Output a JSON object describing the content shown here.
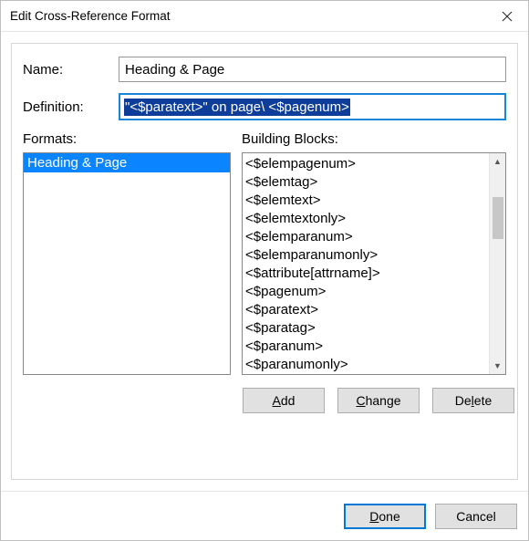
{
  "title": "Edit Cross-Reference Format",
  "labels": {
    "name": "Name:",
    "definition": "Definition:",
    "formats": "Formats:",
    "building_blocks": "Building Blocks:"
  },
  "fields": {
    "name_value": "Heading & Page",
    "definition_value": "\"<$paratext>\" on page\\ <$pagenum>"
  },
  "formats": [
    {
      "label": "Heading & Page",
      "selected": true
    }
  ],
  "building_blocks": [
    "<$elempagenum>",
    "<$elemtag>",
    "<$elemtext>",
    "<$elemtextonly>",
    "<$elemparanum>",
    "<$elemparanumonly>",
    "<$attribute[attrname]>",
    "<$pagenum>",
    "<$paratext>",
    "<$paratag>",
    "<$paranum>",
    "<$paranumonly>"
  ],
  "buttons": {
    "add": {
      "pre": "",
      "u": "A",
      "post": "dd"
    },
    "change": {
      "pre": "",
      "u": "C",
      "post": "hange"
    },
    "delete": {
      "pre": "De",
      "u": "l",
      "post": "ete"
    },
    "done": {
      "pre": "",
      "u": "D",
      "post": "one"
    },
    "cancel": "Cancel"
  }
}
